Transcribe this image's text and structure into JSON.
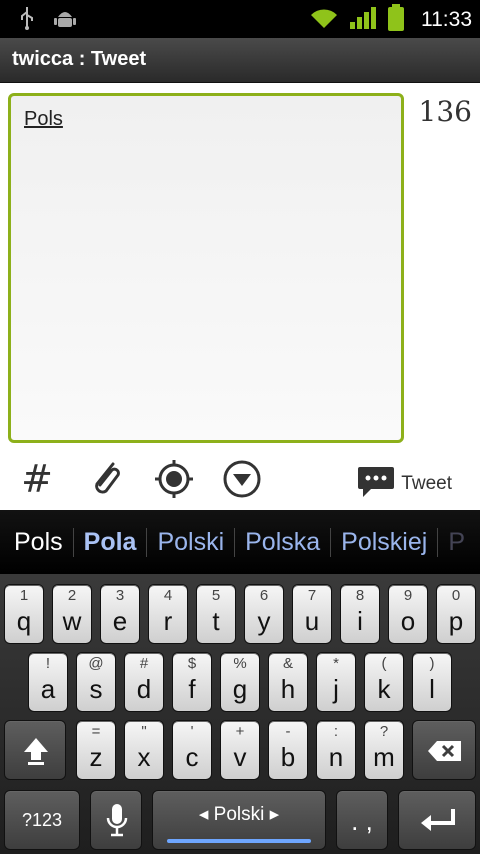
{
  "status_bar": {
    "time": "11:33",
    "icons": [
      "usb-icon",
      "android-debug-icon",
      "wifi-icon",
      "signal-icon",
      "battery-icon"
    ]
  },
  "title_bar": {
    "title": "twicca : Tweet"
  },
  "compose": {
    "text": "Pols",
    "remaining_chars": "136",
    "accent_color": "#8db01a",
    "tools": [
      "hashtag-icon",
      "attachment-icon",
      "location-icon",
      "dropdown-icon"
    ],
    "tweet_label": "Tweet"
  },
  "suggestions": {
    "typed": "Pols",
    "items": [
      "Pola",
      "Polski",
      "Polska",
      "Polskiej"
    ],
    "partial": "P"
  },
  "keyboard": {
    "row1": [
      {
        "main": "q",
        "alt": "1"
      },
      {
        "main": "w",
        "alt": "2"
      },
      {
        "main": "e",
        "alt": "3"
      },
      {
        "main": "r",
        "alt": "4"
      },
      {
        "main": "t",
        "alt": "5"
      },
      {
        "main": "y",
        "alt": "6"
      },
      {
        "main": "u",
        "alt": "7"
      },
      {
        "main": "i",
        "alt": "8"
      },
      {
        "main": "o",
        "alt": "9"
      },
      {
        "main": "p",
        "alt": "0"
      }
    ],
    "row2": [
      {
        "main": "a",
        "alt": "!"
      },
      {
        "main": "s",
        "alt": "@"
      },
      {
        "main": "d",
        "alt": "#"
      },
      {
        "main": "f",
        "alt": "$"
      },
      {
        "main": "g",
        "alt": "%"
      },
      {
        "main": "h",
        "alt": "&"
      },
      {
        "main": "j",
        "alt": "*"
      },
      {
        "main": "k",
        "alt": "("
      },
      {
        "main": "l",
        "alt": ")"
      }
    ],
    "row3": [
      {
        "main": "z",
        "alt": "="
      },
      {
        "main": "x",
        "alt": "\""
      },
      {
        "main": "c",
        "alt": "'"
      },
      {
        "main": "v",
        "alt": "+"
      },
      {
        "main": "b",
        "alt": "-"
      },
      {
        "main": "n",
        "alt": ":"
      },
      {
        "main": "m",
        "alt": "?"
      }
    ],
    "symbols_label": "?123",
    "space_label": "◂ Polski ▸",
    "punct_label": ". ,"
  }
}
